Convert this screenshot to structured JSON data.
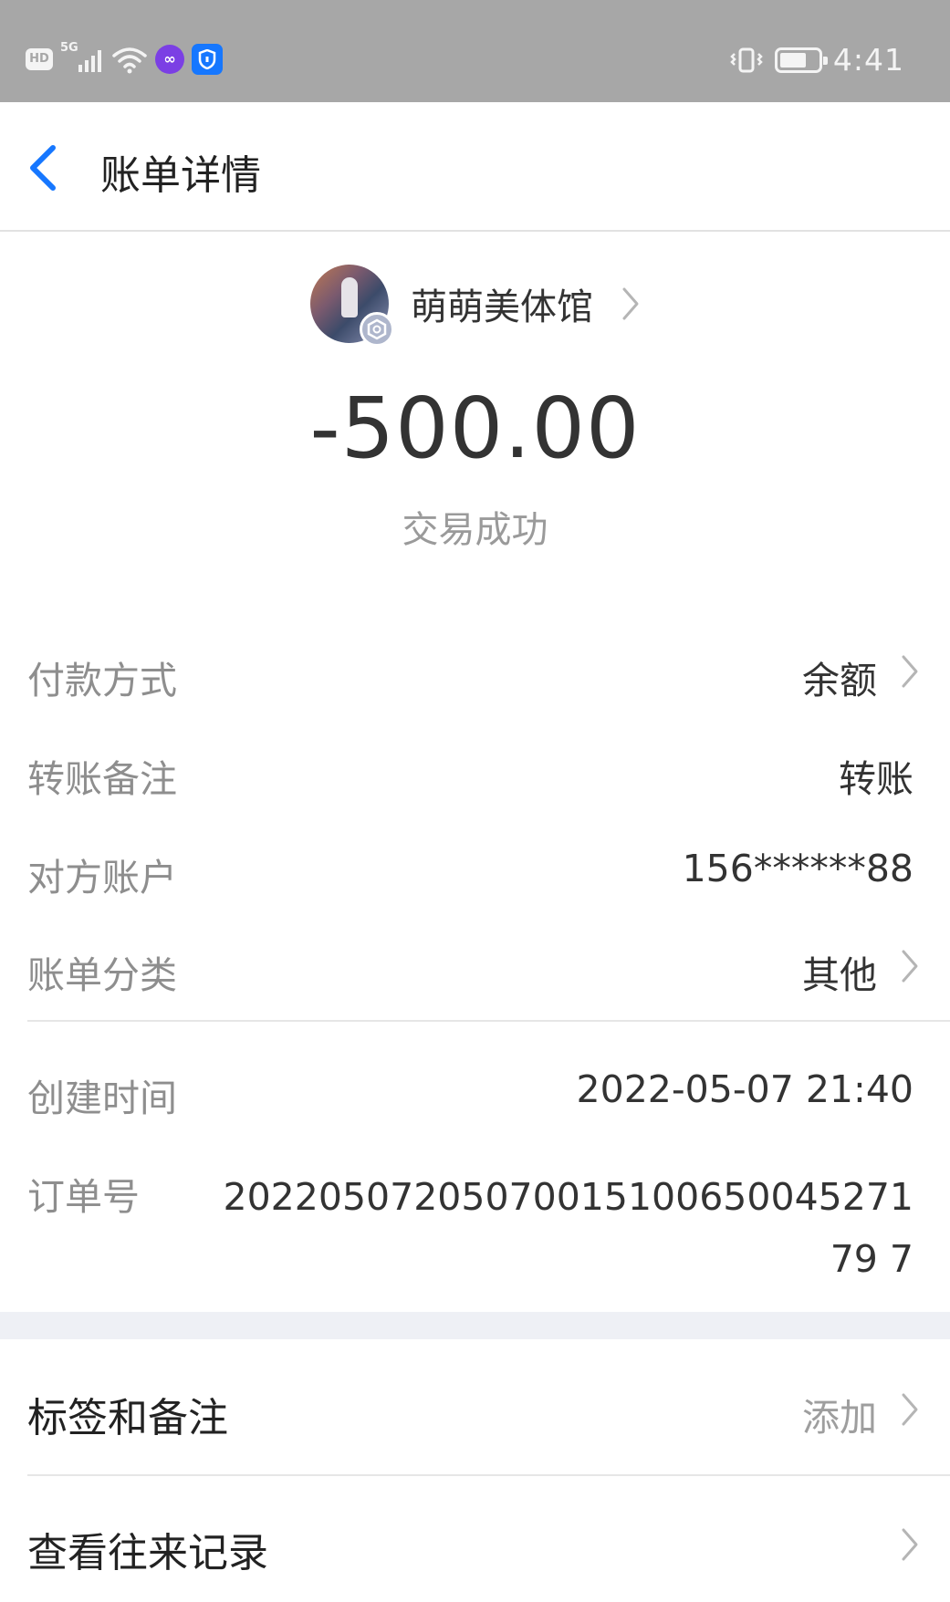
{
  "status_bar": {
    "left_icons": [
      "hd-icon",
      "5g-signal-icon",
      "wifi-icon",
      "link-app-icon",
      "shield-app-icon"
    ],
    "hd_label": "HD",
    "network_label": "5G",
    "app_circle_glyph": "∞",
    "right_icons": [
      "vibrate-icon",
      "battery-icon"
    ],
    "battery_level": 0.7,
    "time": "4:41"
  },
  "nav": {
    "title": "账单详情",
    "back_icon": "chevron-left-icon",
    "accent_color": "#1677ff"
  },
  "merchant": {
    "name": "萌萌美体馆",
    "avatar_badge_icon": "verified-hexagon-icon"
  },
  "transaction": {
    "amount": "-500.00",
    "status": "交易成功"
  },
  "details": [
    {
      "label": "付款方式",
      "value": "余额"
    },
    {
      "label": "转账备注",
      "value": "转账"
    },
    {
      "label": "对方账户",
      "value": "156******88"
    },
    {
      "label": "账单分类",
      "value": "其他"
    }
  ],
  "meta": [
    {
      "label": "创建时间",
      "value": "2022-05-07 21:40"
    },
    {
      "label": "订单号",
      "value": "2022050720507001510065004527179 7"
    }
  ],
  "actions": {
    "tags_label": "标签和备注",
    "tags_hint": "添加",
    "history_label": "查看往来记录"
  }
}
